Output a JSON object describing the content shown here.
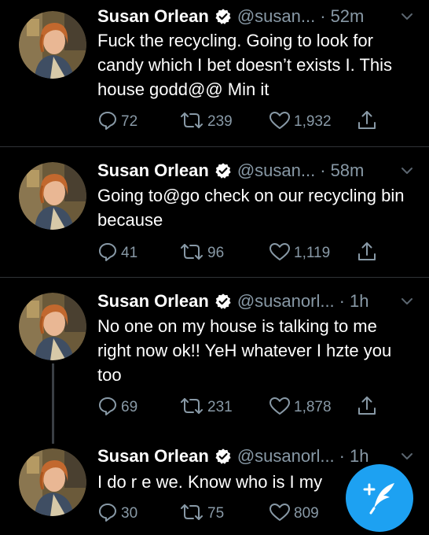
{
  "colors": {
    "background": "#000000",
    "text": "#ffffff",
    "secondary_text": "#8899a6",
    "divider": "#2f3336",
    "accent": "#1da1f2"
  },
  "tweets": [
    {
      "name": "Susan Orlean",
      "handle": "@susan...",
      "time": "52m",
      "text": "Fuck the recycling. Going to look for candy which I bet doesn’t exists I. This house godd@@ Min it",
      "replies": "72",
      "retweets": "239",
      "likes": "1,932"
    },
    {
      "name": "Susan Orlean",
      "handle": "@susan...",
      "time": "58m",
      "text": "Going to@go check on our recycling bin because",
      "replies": "41",
      "retweets": "96",
      "likes": "1,119"
    },
    {
      "name": "Susan Orlean",
      "handle": "@susanorl...",
      "time": "1h",
      "text": "No one on my house is talking to me right now ok!! YeH whatever I hzte you too",
      "replies": "69",
      "retweets": "231",
      "likes": "1,878"
    },
    {
      "name": "Susan Orlean",
      "handle": "@susanorl...",
      "time": "1h",
      "text": "I do r e we. Know who is I my",
      "replies": "30",
      "retweets": "75",
      "likes": "809"
    }
  ],
  "separator": "·",
  "icons": {
    "verified": "verified-badge-icon",
    "caret": "chevron-down-icon",
    "reply": "reply-icon",
    "retweet": "retweet-icon",
    "like": "heart-icon",
    "share": "share-icon",
    "compose": "compose-tweet-icon"
  }
}
